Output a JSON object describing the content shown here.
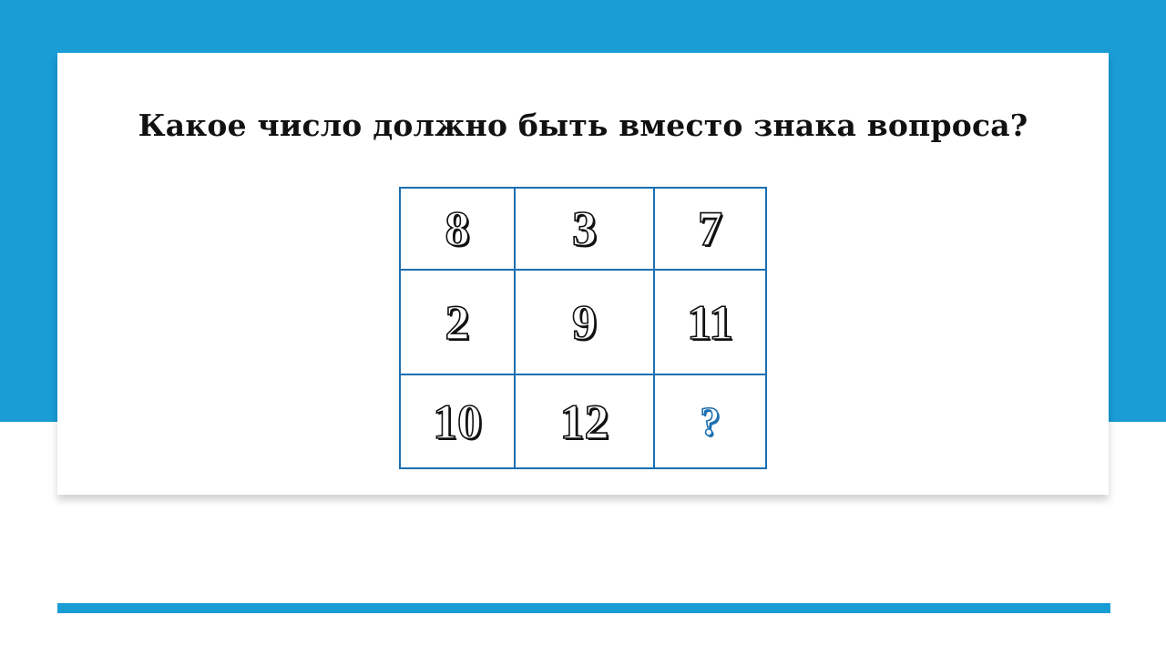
{
  "slide": {
    "question_text": "Какое число должно быть вместо знака вопроса",
    "question_mark": "?",
    "grid": [
      [
        "8",
        "3",
        "7"
      ],
      [
        "2",
        "9",
        "11"
      ],
      [
        "10",
        "12",
        "?"
      ]
    ],
    "colors": {
      "accent": "#1a9cd5",
      "grid_border": "#1b6fb1",
      "unknown_mark": "#1b6fb1"
    }
  }
}
